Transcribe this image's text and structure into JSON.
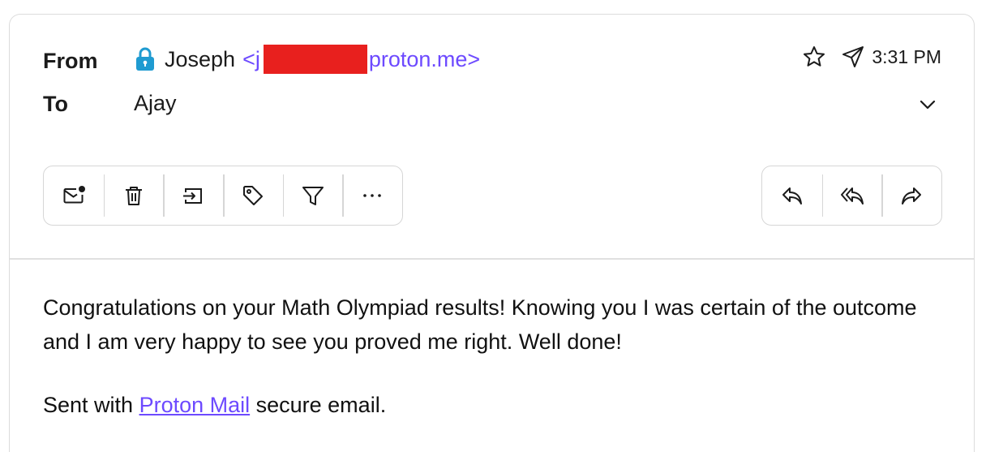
{
  "header": {
    "from_label": "From",
    "to_label": "To",
    "sender_name": "Joseph",
    "sender_email_prefix": "<j",
    "sender_email_suffix": "proton.me>",
    "recipient": "Ajay",
    "time": "3:31 PM"
  },
  "toolbar": {
    "left": [
      "mark-unread",
      "trash",
      "move-to",
      "label",
      "filter",
      "more"
    ],
    "right": [
      "reply",
      "reply-all",
      "forward"
    ]
  },
  "message": {
    "body": "Congratulations on your Math Olympiad results! Knowing you I was certain of the outcome and I am very happy to see you proved me right. Well done!",
    "signature_prefix": "Sent with ",
    "signature_link": "Proton Mail",
    "signature_suffix": " secure email."
  },
  "colors": {
    "accent": "#6d4aff",
    "lock": "#1f9bd1",
    "redaction": "#e8201e",
    "border": "#d6d6d6"
  }
}
